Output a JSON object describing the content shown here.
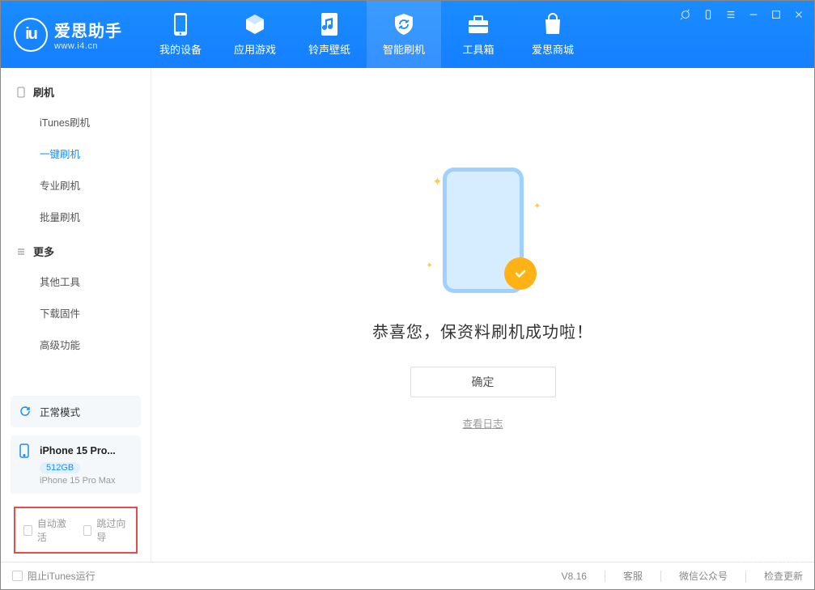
{
  "app": {
    "name": "爱思助手",
    "url": "www.i4.cn"
  },
  "nav": {
    "items": [
      {
        "label": "我的设备"
      },
      {
        "label": "应用游戏"
      },
      {
        "label": "铃声壁纸"
      },
      {
        "label": "智能刷机"
      },
      {
        "label": "工具箱"
      },
      {
        "label": "爱思商城"
      }
    ]
  },
  "sidebar": {
    "sections": [
      {
        "title": "刷机",
        "items": [
          {
            "label": "iTunes刷机"
          },
          {
            "label": "一键刷机"
          },
          {
            "label": "专业刷机"
          },
          {
            "label": "批量刷机"
          }
        ]
      },
      {
        "title": "更多",
        "items": [
          {
            "label": "其他工具"
          },
          {
            "label": "下载固件"
          },
          {
            "label": "高级功能"
          }
        ]
      }
    ],
    "mode": "正常模式",
    "device": {
      "name": "iPhone 15 Pro...",
      "storage": "512GB",
      "model": "iPhone 15 Pro Max"
    },
    "options": {
      "autoActivate": "自动激活",
      "skipWizard": "跳过向导"
    }
  },
  "main": {
    "successText": "恭喜您，保资料刷机成功啦！",
    "okButton": "确定",
    "viewLog": "查看日志"
  },
  "statusbar": {
    "blockItunes": "阻止iTunes运行",
    "version": "V8.16",
    "links": {
      "support": "客服",
      "wechat": "微信公众号",
      "checkUpdate": "检查更新"
    }
  }
}
